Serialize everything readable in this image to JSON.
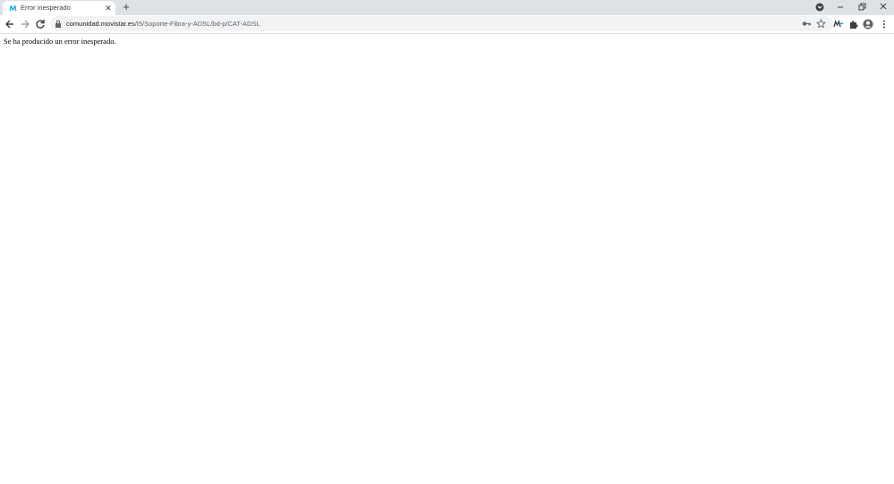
{
  "browser": {
    "tab": {
      "title": "Error inesperado",
      "close_label": "✕",
      "favicon": "movistar-m-icon"
    },
    "new_tab_label": "+",
    "window_controls": {
      "minimize": "minimize-icon",
      "maximize": "restore-icon",
      "close": "close-icon"
    },
    "toolbar": {
      "url_host": "comunidad.movistar.es",
      "url_path": "/t5/Soporte-Fibra-y-ADSL/bd-p/CAT-ADSL",
      "icons": [
        "back-icon",
        "forward-icon",
        "reload-icon",
        "lock-icon",
        "key-icon",
        "star-icon",
        "extension-m-icon",
        "puzzle-icon",
        "profile-icon",
        "menu-icon"
      ]
    },
    "colors": {
      "tabstrip": "#dee1e6",
      "omnibox": "#f1f3f4",
      "accent": "#019df4"
    }
  },
  "page": {
    "error_message": "Se ha producido un error inesperado."
  }
}
